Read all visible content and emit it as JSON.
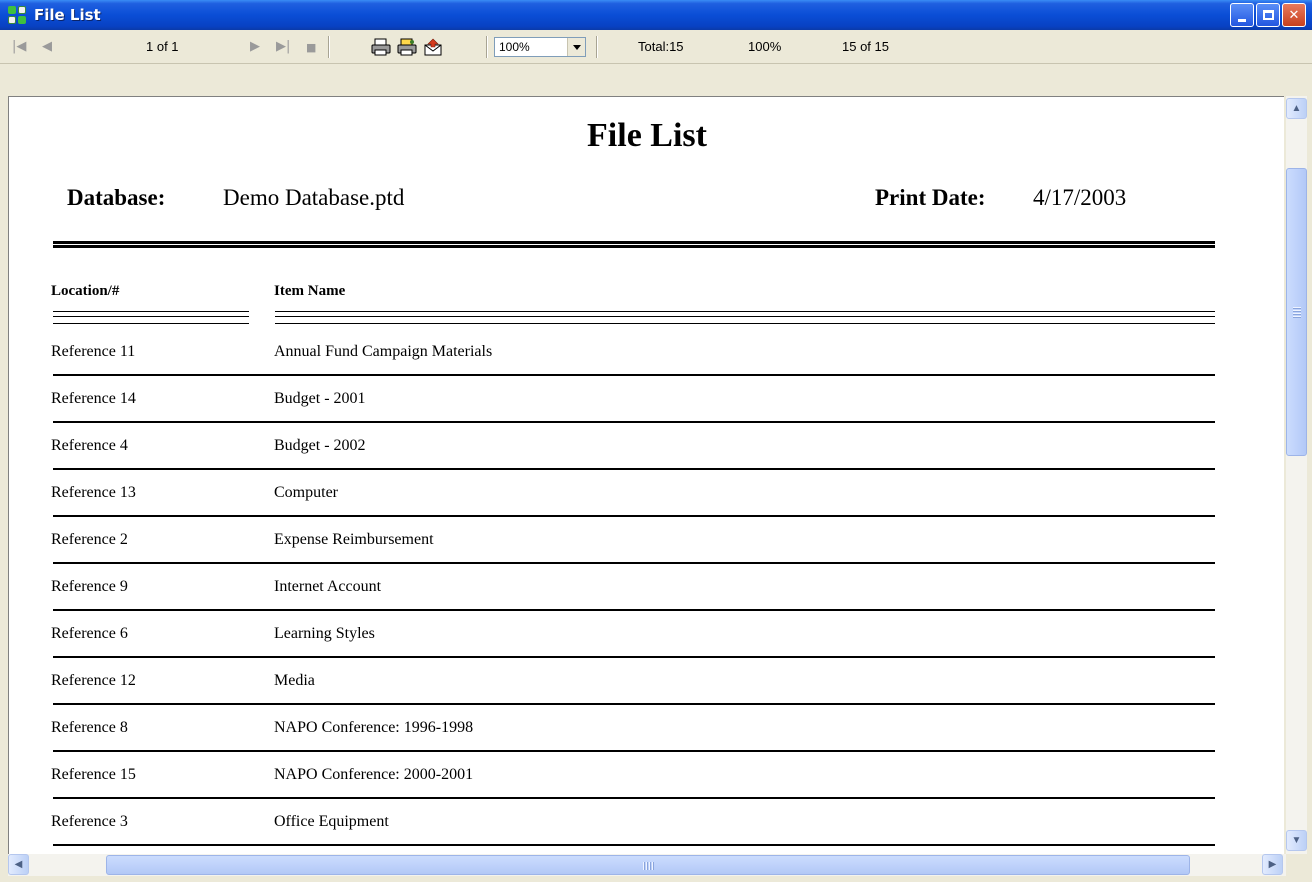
{
  "window": {
    "title": "File List"
  },
  "toolbar": {
    "page_status": "1 of 1",
    "zoom_value": "100%",
    "total": "Total:15",
    "percent": "100%",
    "records": "15 of 15"
  },
  "report": {
    "title": "File List",
    "database_label": "Database:",
    "database_value": "Demo Database.ptd",
    "print_date_label": "Print Date:",
    "print_date_value": "4/17/2003",
    "columns": [
      "Location/#",
      "Item Name"
    ],
    "rows": [
      {
        "location": "Reference 11",
        "item": "Annual Fund Campaign Materials"
      },
      {
        "location": "Reference 14",
        "item": "Budget - 2001"
      },
      {
        "location": "Reference 4",
        "item": "Budget - 2002"
      },
      {
        "location": "Reference 13",
        "item": "Computer"
      },
      {
        "location": "Reference 2",
        "item": "Expense Reimbursement"
      },
      {
        "location": "Reference 9",
        "item": "Internet Account"
      },
      {
        "location": "Reference 6",
        "item": "Learning Styles"
      },
      {
        "location": "Reference 12",
        "item": "Media"
      },
      {
        "location": "Reference 8",
        "item": "NAPO Conference: 1996-1998"
      },
      {
        "location": "Reference 15",
        "item": "NAPO Conference: 2000-2001"
      },
      {
        "location": "Reference 3",
        "item": "Office Equipment"
      }
    ]
  },
  "colors": {
    "titlebar": "#0a4ed6",
    "scrollbar": "#bfd2fb",
    "close_button": "#c8401e"
  }
}
